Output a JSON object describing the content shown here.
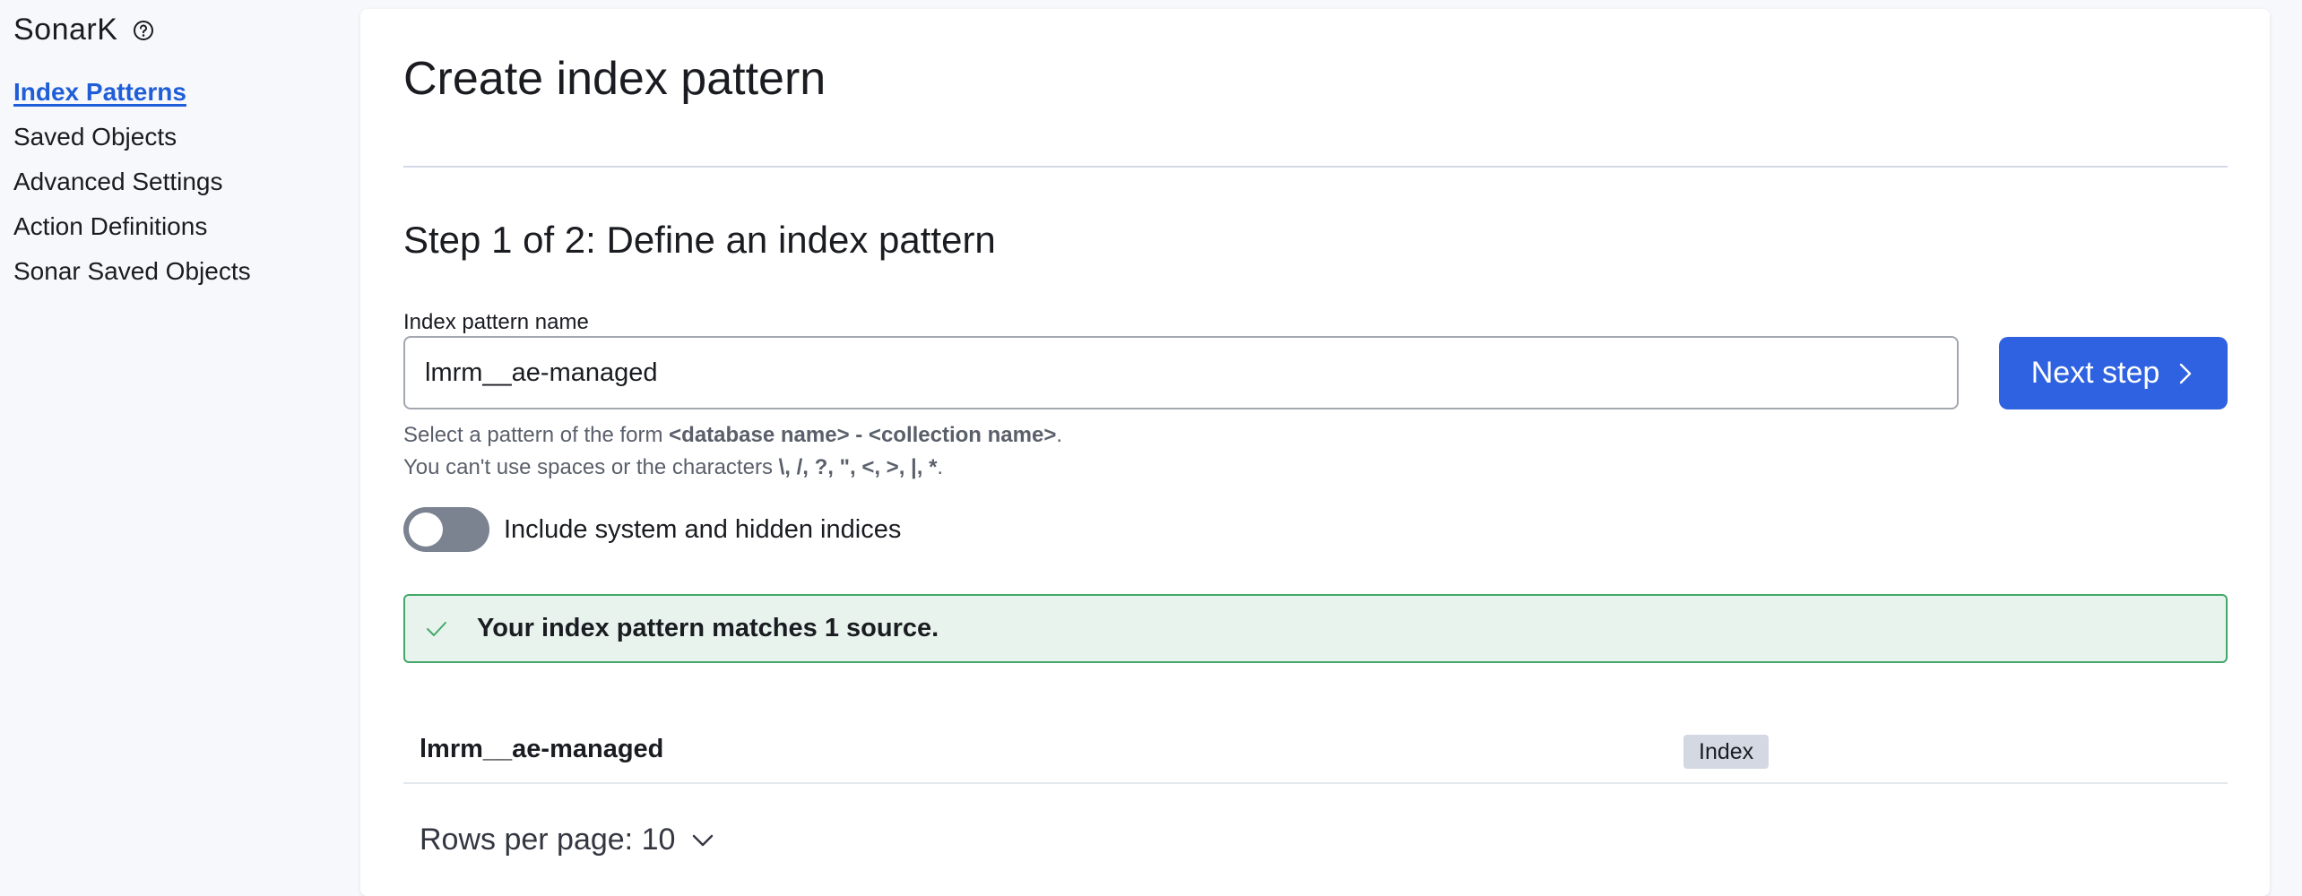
{
  "app": {
    "title": "SonarK"
  },
  "sidebar": {
    "items": [
      {
        "label": "Index Patterns",
        "active": true
      },
      {
        "label": "Saved Objects"
      },
      {
        "label": "Advanced Settings"
      },
      {
        "label": "Action Definitions"
      },
      {
        "label": "Sonar Saved Objects"
      }
    ]
  },
  "main": {
    "title": "Create index pattern",
    "step_title": "Step 1 of 2: Define an index pattern",
    "field_label": "Index pattern name",
    "input_value": "lmrm__ae-managed",
    "next_button_label": "Next step",
    "help": {
      "line1_prefix": "Select a pattern of the form ",
      "line1_bold": "<database name> - <collection name>",
      "line1_suffix": ".",
      "line2_prefix": "You can't use spaces or the characters ",
      "line2_bold": "\\, /, ?, \", <, >, |, *",
      "line2_suffix": "."
    },
    "toggle_label": "Include system and hidden indices",
    "toggle_on": false,
    "callout_text": "Your index pattern matches 1 source.",
    "results": [
      {
        "name": "lmrm__ae-managed",
        "type": "Index"
      }
    ],
    "pagination": {
      "rows_per_page_label": "Rows per page: 10"
    }
  },
  "colors": {
    "accent": "#2f62e0",
    "link_active": "#1f5ed8",
    "success_border": "#43a86a",
    "success_bg": "#e8f3ed"
  },
  "icons": {
    "help": "question-circle-icon",
    "next": "chevron-right-icon",
    "check": "check-icon",
    "rows": "chevron-down-icon"
  }
}
